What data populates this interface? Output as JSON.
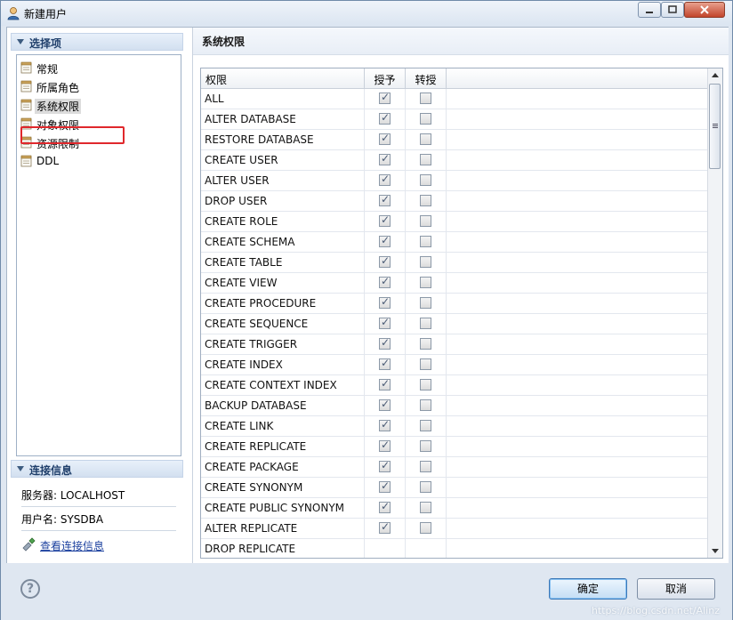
{
  "window": {
    "title": "新建用户"
  },
  "left": {
    "section1_title": "选择项",
    "tree": [
      {
        "label": "常规"
      },
      {
        "label": "所属角色"
      },
      {
        "label": "系统权限",
        "selected": true
      },
      {
        "label": "对象权限"
      },
      {
        "label": "资源限制"
      },
      {
        "label": "DDL"
      }
    ],
    "section2_title": "连接信息",
    "server": "服务器: LOCALHOST",
    "username": "用户名: SYSDBA",
    "view_link": "查看连接信息"
  },
  "right": {
    "title": "系统权限",
    "columns": {
      "name": "权限",
      "grant": "授予",
      "regrant": "转授"
    },
    "rows": [
      {
        "name": "ALL",
        "grant": true,
        "regrant": false
      },
      {
        "name": "ALTER DATABASE",
        "grant": true,
        "regrant": false
      },
      {
        "name": "RESTORE DATABASE",
        "grant": true,
        "regrant": false
      },
      {
        "name": "CREATE USER",
        "grant": true,
        "regrant": false
      },
      {
        "name": "ALTER USER",
        "grant": true,
        "regrant": false
      },
      {
        "name": "DROP USER",
        "grant": true,
        "regrant": false
      },
      {
        "name": "CREATE ROLE",
        "grant": true,
        "regrant": false
      },
      {
        "name": "CREATE SCHEMA",
        "grant": true,
        "regrant": false
      },
      {
        "name": "CREATE TABLE",
        "grant": true,
        "regrant": false
      },
      {
        "name": "CREATE VIEW",
        "grant": true,
        "regrant": false
      },
      {
        "name": "CREATE PROCEDURE",
        "grant": true,
        "regrant": false
      },
      {
        "name": "CREATE SEQUENCE",
        "grant": true,
        "regrant": false
      },
      {
        "name": "CREATE TRIGGER",
        "grant": true,
        "regrant": false
      },
      {
        "name": "CREATE INDEX",
        "grant": true,
        "regrant": false
      },
      {
        "name": "CREATE CONTEXT INDEX",
        "grant": true,
        "regrant": false
      },
      {
        "name": "BACKUP DATABASE",
        "grant": true,
        "regrant": false
      },
      {
        "name": "CREATE LINK",
        "grant": true,
        "regrant": false
      },
      {
        "name": "CREATE REPLICATE",
        "grant": true,
        "regrant": false
      },
      {
        "name": "CREATE PACKAGE",
        "grant": true,
        "regrant": false
      },
      {
        "name": "CREATE SYNONYM",
        "grant": true,
        "regrant": false
      },
      {
        "name": "CREATE PUBLIC SYNONYM",
        "grant": true,
        "regrant": false
      },
      {
        "name": "ALTER REPLICATE",
        "grant": true,
        "regrant": false
      },
      {
        "name": "DROP REPLICATE",
        "grant": false,
        "regrant": false
      }
    ]
  },
  "footer": {
    "ok": "确定",
    "cancel": "取消",
    "help": "?"
  },
  "watermark": "https://blog.csdn.net/Alinz",
  "colors": {
    "highlight_box": "#e0282c",
    "link": "#1a3f9e"
  }
}
